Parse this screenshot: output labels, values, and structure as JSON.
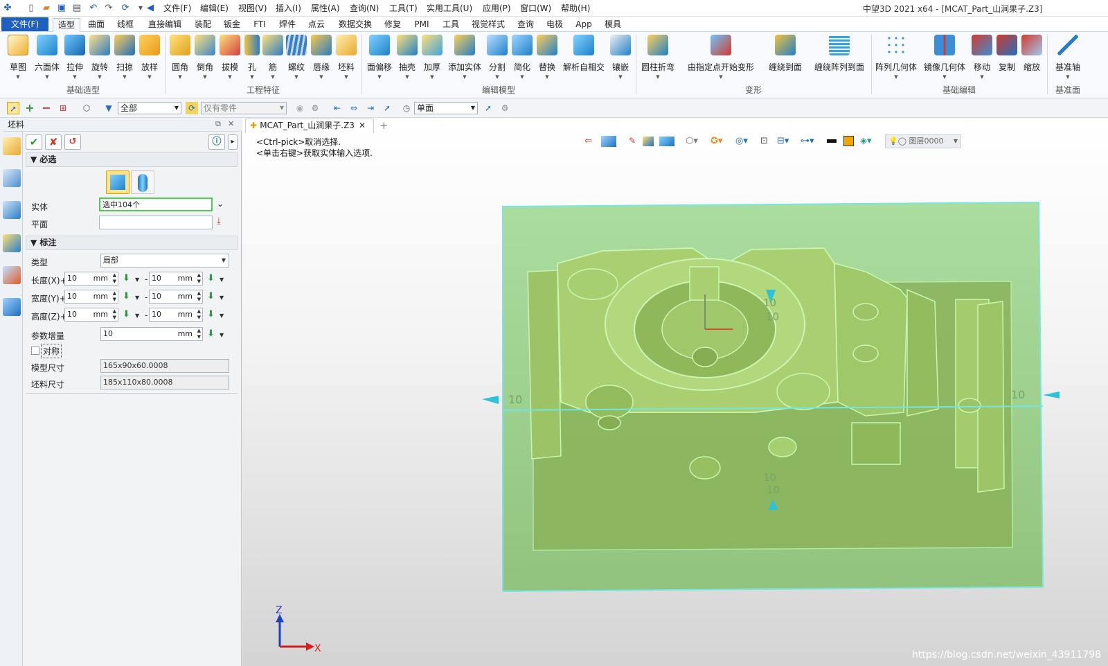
{
  "window_title": "中望3D 2021 x64 - [MCAT_Part_山涧果子.Z3]",
  "menus": [
    "文件(F)",
    "编辑(E)",
    "视图(V)",
    "插入(I)",
    "属性(A)",
    "查询(N)",
    "工具(T)",
    "实用工具(U)",
    "应用(P)",
    "窗口(W)",
    "帮助(H)"
  ],
  "ribbon_tabs": [
    "文件(F)",
    "造型",
    "曲面",
    "线框",
    "直接编辑",
    "装配",
    "钣金",
    "FTI",
    "焊件",
    "点云",
    "数据交换",
    "修复",
    "PMI",
    "工具",
    "视觉样式",
    "查询",
    "电极",
    "App",
    "模具"
  ],
  "ribbon_groups": [
    {
      "label": "基础造型",
      "buttons": [
        "草图",
        "六面体",
        "拉伸",
        "旋转",
        "扫掠",
        "放样"
      ]
    },
    {
      "label": "工程特征",
      "buttons": [
        "圆角",
        "倒角",
        "拔模",
        "孔",
        "筋",
        "螺纹",
        "唇缘",
        "坯料"
      ]
    },
    {
      "label": "编辑模型",
      "buttons": [
        "面偏移",
        "抽壳",
        "加厚",
        "添加实体",
        "分割",
        "简化",
        "替换",
        "解析自相交",
        "镶嵌"
      ]
    },
    {
      "label": "变形",
      "buttons": [
        "圆柱折弯",
        "由指定点开始变形",
        "缠绕到面",
        "缠绕阵列到面"
      ]
    },
    {
      "label": "基础编辑",
      "buttons": [
        "阵列几何体",
        "镜像几何体",
        "移动",
        "复制",
        "缩放"
      ]
    },
    {
      "label": "基准面",
      "buttons": [
        "基准轴"
      ]
    }
  ],
  "toolbar": {
    "filter": "全部",
    "part_filter": "仅有零件",
    "face_mode": "单面"
  },
  "panel": {
    "title": "坯料",
    "required_section": "必选",
    "entity_label": "实体",
    "entity_value": "选中104个",
    "plane_label": "平面",
    "plane_value": "",
    "annot_section": "标注",
    "type_label": "类型",
    "type_value": "局部",
    "rows": [
      {
        "label": "长度(X)+",
        "plus": "10",
        "minus": "10",
        "unit": "mm"
      },
      {
        "label": "宽度(Y)+",
        "plus": "10",
        "minus": "10",
        "unit": "mm"
      },
      {
        "label": "高度(Z)+",
        "plus": "10",
        "minus": "10",
        "unit": "mm"
      }
    ],
    "increment_label": "参数增量",
    "increment_value": "10",
    "increment_unit": "mm",
    "symmetric_label": "对称",
    "model_size_label": "模型尺寸",
    "model_size_value": "165x90x60.0008",
    "blank_size_label": "坯料尺寸",
    "blank_size_value": "185x110x80.0008"
  },
  "document_tab": "MCAT_Part_山涧果子.Z3",
  "hints": [
    "<Ctrl-pick>取消选择.",
    "<单击右键>获取实体输入选项."
  ],
  "layer": "图层0000",
  "dim_labels": {
    "left": "10",
    "right": "10",
    "top1": "10",
    "top2": "10",
    "bottom1": "10",
    "bottom2": "10"
  },
  "axis_labels": {
    "z": "Z",
    "x": "X"
  },
  "watermark": "https://blog.csdn.net/weixin_43911798"
}
